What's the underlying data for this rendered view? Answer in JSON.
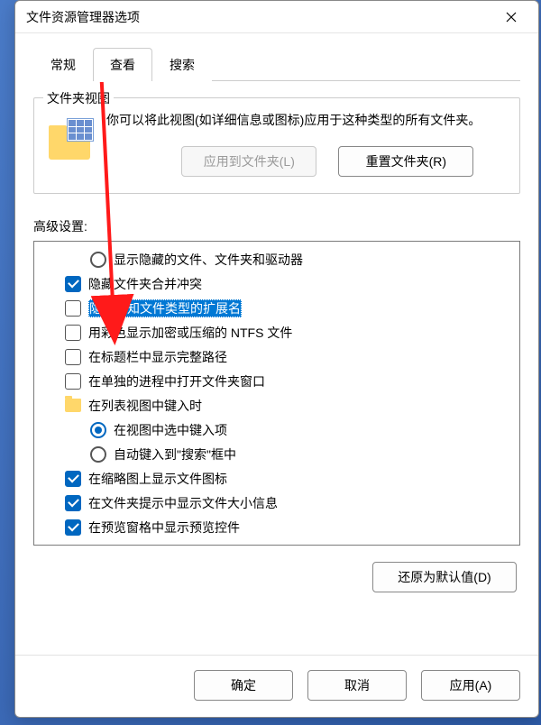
{
  "title": "文件资源管理器选项",
  "tabs": {
    "general": "常规",
    "view": "查看",
    "search": "搜索"
  },
  "folderview": {
    "group_label": "文件夹视图",
    "desc": "你可以将此视图(如详细信息或图标)应用于这种类型的所有文件夹。",
    "apply_btn": "应用到文件夹(L)",
    "reset_btn": "重置文件夹(R)"
  },
  "advanced_label": "高级设置:",
  "items": [
    {
      "type": "radio",
      "checked": false,
      "indent": 2,
      "label": "显示隐藏的文件、文件夹和驱动器"
    },
    {
      "type": "check",
      "checked": true,
      "indent": 1,
      "label": "隐藏文件夹合并冲突"
    },
    {
      "type": "check",
      "checked": false,
      "indent": 1,
      "label": "隐藏已知文件类型的扩展名",
      "selected": true
    },
    {
      "type": "check",
      "checked": false,
      "indent": 1,
      "label": "用彩色显示加密或压缩的 NTFS 文件"
    },
    {
      "type": "check",
      "checked": false,
      "indent": 1,
      "label": "在标题栏中显示完整路径"
    },
    {
      "type": "check",
      "checked": false,
      "indent": 1,
      "label": "在单独的进程中打开文件夹窗口"
    },
    {
      "type": "folder",
      "indent": 1,
      "label": "在列表视图中键入时"
    },
    {
      "type": "radio",
      "checked": true,
      "indent": 2,
      "label": "在视图中选中键入项"
    },
    {
      "type": "radio",
      "checked": false,
      "indent": 2,
      "label": "自动键入到\"搜索\"框中"
    },
    {
      "type": "check",
      "checked": true,
      "indent": 1,
      "label": "在缩略图上显示文件图标"
    },
    {
      "type": "check",
      "checked": true,
      "indent": 1,
      "label": "在文件夹提示中显示文件大小信息"
    },
    {
      "type": "check",
      "checked": true,
      "indent": 1,
      "label": "在预览窗格中显示预览控件"
    }
  ],
  "restore_btn": "还原为默认值(D)",
  "footer": {
    "ok": "确定",
    "cancel": "取消",
    "apply": "应用(A)"
  }
}
